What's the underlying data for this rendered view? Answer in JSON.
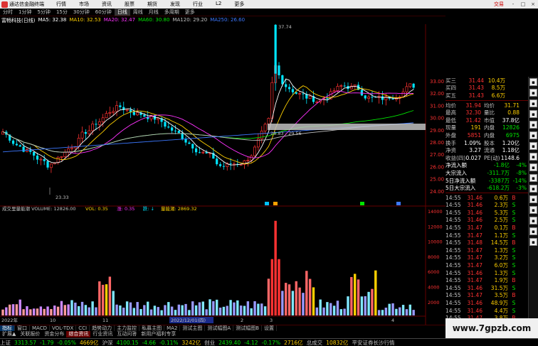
{
  "menubar": {
    "app_title": "通达信金融终端",
    "items": [
      "行情",
      "市场",
      "资讯",
      "股票",
      "期货",
      "发现",
      "行业",
      "L2",
      "更多"
    ],
    "trade_label": "交易",
    "window_buttons": [
      "-",
      "□",
      "×"
    ]
  },
  "periodbar": {
    "items": [
      "分时",
      "1分钟",
      "5分钟",
      "15分",
      "30分钟",
      "60分钟",
      "日线",
      "周线",
      "月线",
      "多周期",
      "更多"
    ],
    "active_index": 6
  },
  "ma_line": {
    "stock": "富畅科技(日线)",
    "items": [
      {
        "label": "MA5: 32.38",
        "color": "#ffffff"
      },
      {
        "label": "MA10: 32.53",
        "color": "#ffd000"
      },
      {
        "label": "MA20: 32.47",
        "color": "#ff32ff"
      },
      {
        "label": "MA60: 30.80",
        "color": "#00e600"
      },
      {
        "label": "MA120: 29.20",
        "color": "#c0c0c0"
      },
      {
        "label": "MA250: 26.60",
        "color": "#3c78ff"
      }
    ]
  },
  "price_panel": {
    "ylabels": [
      "33.00",
      "32.00",
      "31.00",
      "30.00",
      "29.00",
      "28.00",
      "27.00",
      "26.00",
      "25.00",
      "24.00"
    ],
    "annotation_high": "37.74",
    "annotation_low": "23.33",
    "box_label": "28.83 - 29.56"
  },
  "volume_panel": {
    "title": "成交里量能潮 VOLUME: 12826.00",
    "items": [
      {
        "label": "VOL: 0.35",
        "color": "#ffd000"
      },
      {
        "label": "涨: 0.35",
        "color": "#ff32ff"
      },
      {
        "label": "跌: ↓",
        "color": "#00e5ff"
      },
      {
        "label": "量能潮: 2869.32",
        "color": "#ffd000"
      }
    ],
    "ylabels": [
      "14000",
      "12000",
      "10000",
      "8000",
      "6000",
      "4000",
      "2000"
    ]
  },
  "time_axis": {
    "labels": [
      "2022年",
      "10",
      "11",
      "2022/12/01(四)",
      "2",
      "3",
      "4"
    ]
  },
  "quote": {
    "bids": [
      {
        "label": "买三",
        "price": "31.44",
        "vol": "10.4万"
      },
      {
        "label": "买四",
        "price": "31.43",
        "vol": "8.5万"
      },
      {
        "label": "买五",
        "price": "31.43",
        "vol": "6.6万"
      }
    ],
    "stats": [
      {
        "l1": "均价",
        "v1": "31.94",
        "l2": "均价",
        "v2": "31.71",
        "c1": "red",
        "c2": "yellow"
      },
      {
        "l1": "最高",
        "v1": "32.30",
        "l2": "量比",
        "v2": "0.88",
        "c1": "red",
        "c2": "yellow"
      },
      {
        "l1": "最低",
        "v1": "31.42",
        "l2": "市值",
        "v2": "37.8亿",
        "c1": "red",
        "c2": "white"
      },
      {
        "l1": "现量",
        "v1": "191",
        "l2": "内盘",
        "v2": "12826",
        "c1": "yellow",
        "c2": "green"
      },
      {
        "l1": "外盘",
        "v1": "5851",
        "l2": "内盘",
        "v2": "6975",
        "c1": "red",
        "c2": "green"
      },
      {
        "l1": "换手",
        "v1": "1.09%",
        "l2": "股本",
        "v2": "1.20亿",
        "c1": "white",
        "c2": "white"
      },
      {
        "l1": "净资",
        "v1": "3.27",
        "l2": "流通",
        "v2": "1.18亿",
        "c1": "white",
        "c2": "white"
      },
      {
        "l1": "收益(四)",
        "v1": "0.027",
        "l2": "PE(动)",
        "v2": "1148.6",
        "c1": "white",
        "c2": "white"
      }
    ],
    "flows": [
      {
        "label": "净流入额",
        "value": "-1.8亿",
        "pct": "-4%"
      },
      {
        "label": "大宗流入",
        "value": "-311.7万",
        "pct": "-8%"
      },
      {
        "label": "5日净流入额",
        "value": "-3387万",
        "pct": "-14%"
      },
      {
        "label": "5日大宗流入",
        "value": "-618.2万",
        "pct": "-3%"
      }
    ],
    "ticks": [
      {
        "t": "14:55",
        "p": "31.46",
        "v": "0.6万",
        "d": "B"
      },
      {
        "t": "14:55",
        "p": "31.46",
        "v": "2.3万",
        "d": "S"
      },
      {
        "t": "14:55",
        "p": "31.46",
        "v": "5.3万",
        "d": "S"
      },
      {
        "t": "14:55",
        "p": "31.46",
        "v": "2.5万",
        "d": "S"
      },
      {
        "t": "14:55",
        "p": "31.47",
        "v": "0.1万",
        "d": "B"
      },
      {
        "t": "14:55",
        "p": "31.47",
        "v": "1.1万",
        "d": "S"
      },
      {
        "t": "14:55",
        "p": "31.48",
        "v": "14.5万",
        "d": "B"
      },
      {
        "t": "14:55",
        "p": "31.47",
        "v": "1.3万",
        "d": "S"
      },
      {
        "t": "14:55",
        "p": "31.47",
        "v": "3.2万",
        "d": "S"
      },
      {
        "t": "14:55",
        "p": "31.47",
        "v": "6.0万",
        "d": "S"
      },
      {
        "t": "14:55",
        "p": "31.46",
        "v": "1.3万",
        "d": "S"
      },
      {
        "t": "14:55",
        "p": "31.47",
        "v": "1.9万",
        "d": "B"
      },
      {
        "t": "14:55",
        "p": "31.46",
        "v": "31.5万",
        "d": "S"
      },
      {
        "t": "14:55",
        "p": "31.47",
        "v": "3.5万",
        "d": "B"
      },
      {
        "t": "14:55",
        "p": "31.46",
        "v": "48.9万",
        "d": "S"
      },
      {
        "t": "14:55",
        "p": "31.46",
        "v": "4.4万",
        "d": "S"
      },
      {
        "t": "14:55",
        "p": "31.47",
        "v": "3.8万",
        "d": "B"
      },
      {
        "t": "14:55",
        "p": "31.47",
        "v": "1.6万",
        "d": "B"
      },
      {
        "t": "14:55",
        "p": "31.46",
        "v": "1.1万",
        "d": "S"
      },
      {
        "t": "14:55",
        "p": "31.47",
        "v": "1.4万",
        "d": "B"
      },
      {
        "t": "14:55",
        "p": "31.47",
        "v": "0.6万",
        "d": "S"
      }
    ]
  },
  "indicator_tabs": {
    "items": [
      "指标",
      "窗口",
      "MACD",
      "VOL-TDX",
      "CCI",
      "趋势动力",
      "主力监控",
      "私募主图",
      "MA2",
      "测试主图",
      "测试幅图A",
      "测试幅图B",
      "设置"
    ],
    "active_index": 0
  },
  "bottom_tabs": {
    "items": [
      "扩展▲",
      "关联报价",
      "资金分布",
      "综合资讯",
      "行业资讯",
      "互动问答",
      "新用户福利专享"
    ],
    "active_index": 3
  },
  "statusbar": {
    "items": [
      {
        "text": "上证",
        "color": "#c0c0c0"
      },
      {
        "text": "3313.57",
        "color": "#00e600"
      },
      {
        "text": "-1.79",
        "color": "#00e600"
      },
      {
        "text": "-0.05%",
        "color": "#00e600"
      },
      {
        "text": "4669亿",
        "color": "#ffd000"
      },
      {
        "text": "沪深",
        "color": "#c0c0c0"
      },
      {
        "text": "4100.15",
        "color": "#00e600"
      },
      {
        "text": "-4.66",
        "color": "#00e600"
      },
      {
        "text": "-0.11%",
        "color": "#00e600"
      },
      {
        "text": "3242亿",
        "color": "#ffd000"
      },
      {
        "text": "创业",
        "color": "#c0c0c0"
      },
      {
        "text": "2439.40",
        "color": "#00e600"
      },
      {
        "text": "-4.12",
        "color": "#00e600"
      },
      {
        "text": "-0.17%",
        "color": "#00e600"
      },
      {
        "text": "2716亿",
        "color": "#ffd000"
      },
      {
        "text": "总成交",
        "color": "#c0c0c0"
      },
      {
        "text": "10832亿",
        "color": "#ffd000"
      },
      {
        "text": "平安证券长沙行情",
        "color": "#c0c0c0"
      }
    ]
  },
  "watermark": "www.7gpzb.com",
  "colors": {
    "up": "#ff3232",
    "down": "#00e5ff",
    "bg": "#000000"
  }
}
